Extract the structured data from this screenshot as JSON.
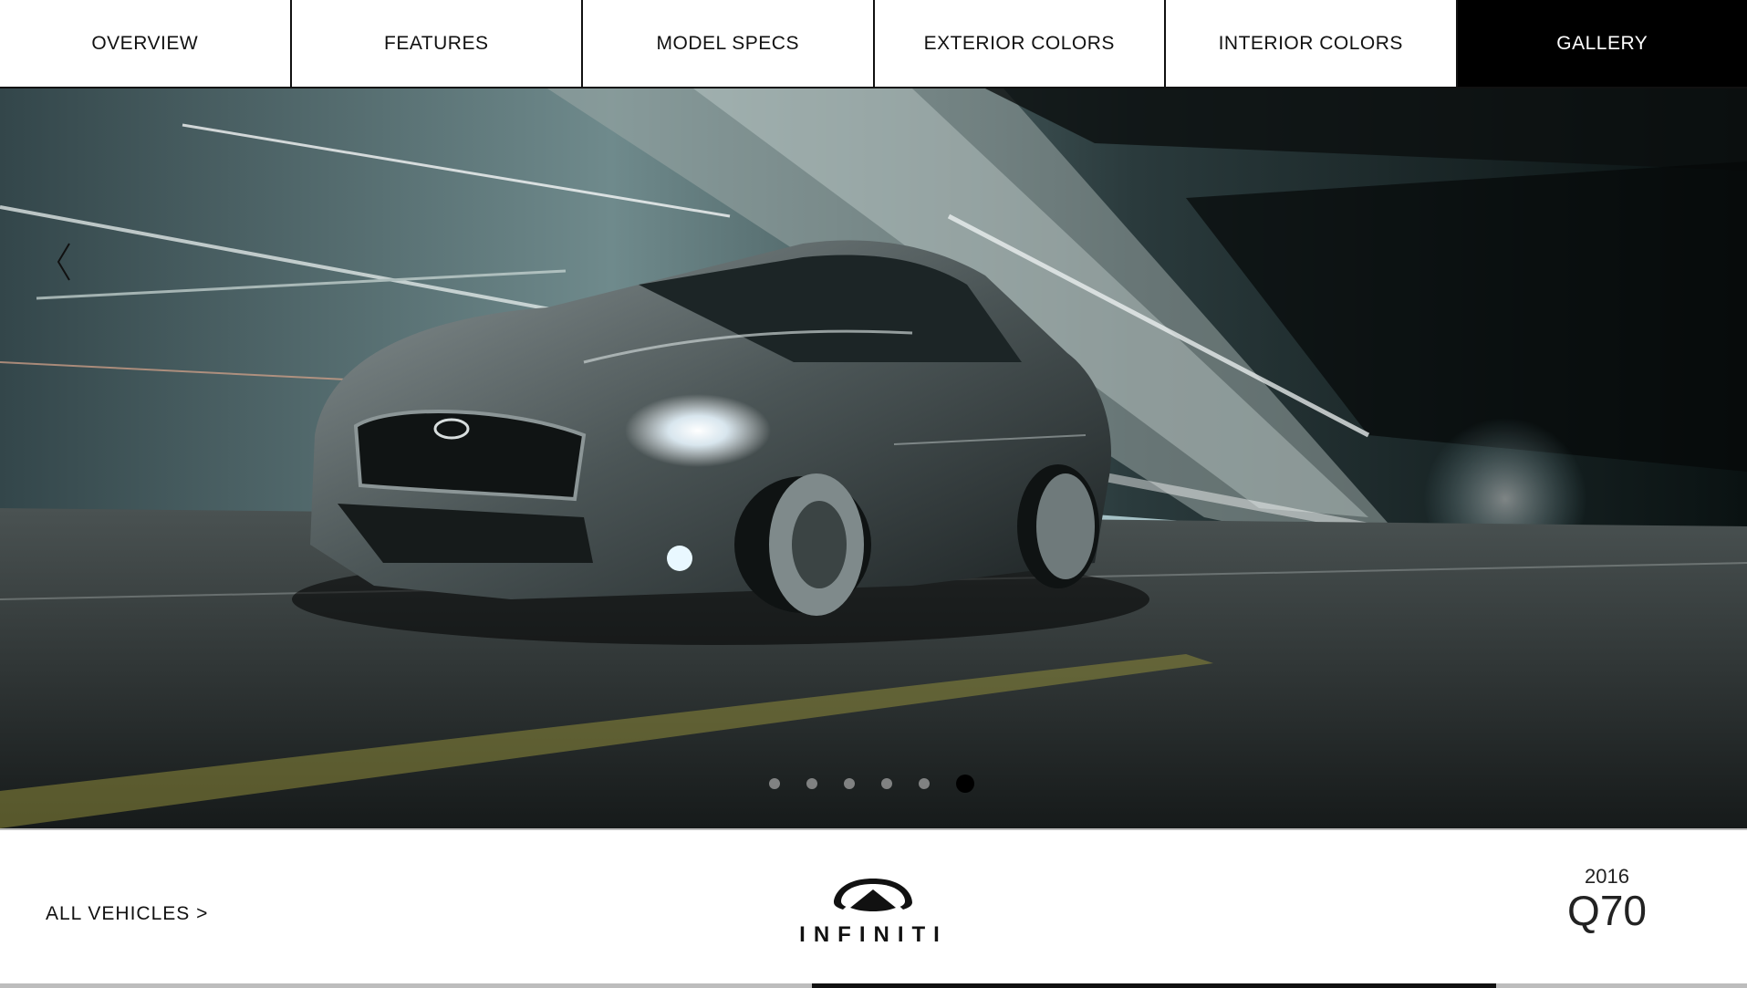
{
  "nav": {
    "tabs": [
      {
        "label": "OVERVIEW",
        "active": false
      },
      {
        "label": "FEATURES",
        "active": false
      },
      {
        "label": "MODEL SPECS",
        "active": false
      },
      {
        "label": "EXTERIOR COLORS",
        "active": false
      },
      {
        "label": "INTERIOR COLORS",
        "active": false
      },
      {
        "label": "GALLERY",
        "active": true
      }
    ]
  },
  "gallery": {
    "prev_icon": "chevron-left-icon",
    "slide_count": 6,
    "active_slide": 6
  },
  "footer": {
    "all_vehicles_label": "ALL VEHICLES >",
    "brand": "INFINITI",
    "model_year": "2016",
    "model_name": "Q70"
  },
  "colors": {
    "active_tab_bg": "#000000",
    "nav_border": "#111111",
    "footer_border": "#bdbdbd"
  }
}
